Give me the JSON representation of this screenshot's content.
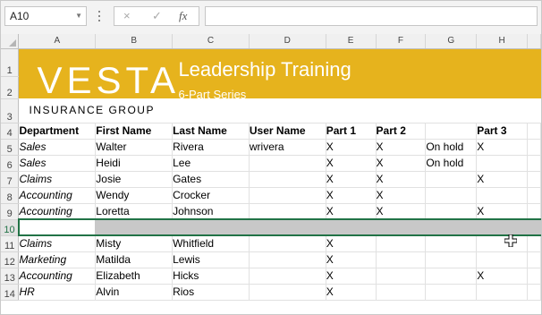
{
  "formula_bar": {
    "name_box": "A10",
    "cancel_icon": "×",
    "enter_icon": "✓",
    "fx_label": "fx",
    "formula_value": ""
  },
  "columns": [
    "A",
    "B",
    "C",
    "D",
    "E",
    "F",
    "G",
    "H"
  ],
  "banner": {
    "logo": "VESTA",
    "title": "Leadership Training",
    "subtitle": "6-Part Series",
    "group": "INSURANCE GROUP",
    "color": "#E6B31D"
  },
  "row_numbers": [
    "1",
    "2",
    "3",
    "4",
    "5",
    "6",
    "7",
    "8",
    "9",
    "10",
    "11",
    "12",
    "13",
    "14"
  ],
  "headers": [
    "Department",
    "First Name",
    "Last Name",
    "User Name",
    "Part 1",
    "Part 2",
    "",
    "Part 3"
  ],
  "rows": [
    [
      "Sales",
      "Walter",
      "Rivera",
      "wrivera",
      "X",
      "X",
      "On hold",
      "X"
    ],
    [
      "Sales",
      "Heidi",
      "Lee",
      "",
      "X",
      "X",
      "On hold",
      ""
    ],
    [
      "Claims",
      "Josie",
      "Gates",
      "",
      "X",
      "X",
      "",
      "X"
    ],
    [
      "Accounting",
      "Wendy",
      "Crocker",
      "",
      "X",
      "X",
      "",
      ""
    ],
    [
      "Accounting",
      "Loretta",
      "Johnson",
      "",
      "X",
      "X",
      "",
      "X"
    ],
    [
      "",
      "",
      "",
      "",
      "",
      "",
      "",
      ""
    ],
    [
      "Claims",
      "Misty",
      "Whitfield",
      "",
      "X",
      "",
      "",
      ""
    ],
    [
      "Marketing",
      "Matilda",
      "Lewis",
      "",
      "X",
      "",
      "",
      ""
    ],
    [
      "Accounting",
      "Elizabeth",
      "Hicks",
      "",
      "X",
      "",
      "",
      "X"
    ],
    [
      "HR",
      "Alvin",
      "Rios",
      "",
      "X",
      "",
      "",
      ""
    ]
  ],
  "selection": {
    "selected_row": "10",
    "accent_color": "#217346"
  },
  "icons": {
    "move_cursor": "move-cursor-icon"
  }
}
